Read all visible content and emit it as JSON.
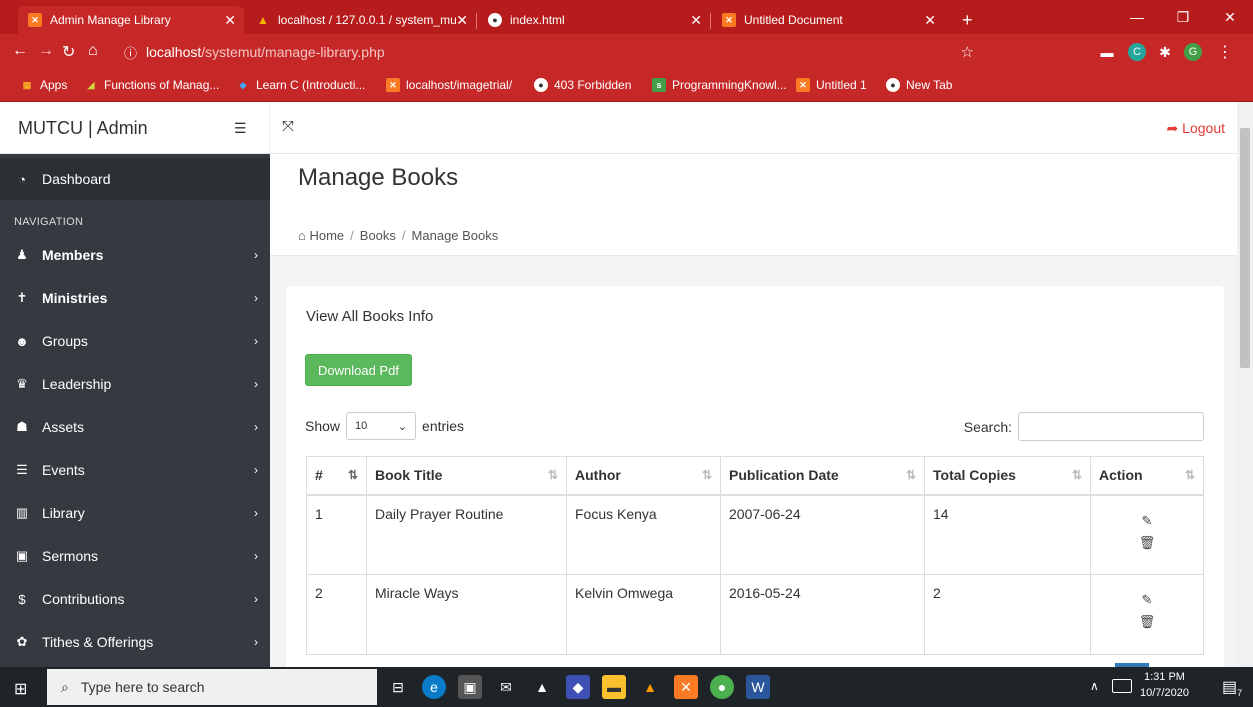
{
  "browser": {
    "tabs": [
      {
        "title": "Admin Manage Library",
        "icon": "xampp-icon"
      },
      {
        "title": "localhost / 127.0.0.1 / system_mu",
        "icon": "phpmyadmin-icon"
      },
      {
        "title": "index.html",
        "icon": "globe-icon"
      },
      {
        "title": "Untitled Document",
        "icon": "xampp-icon"
      }
    ],
    "new_tab": "+",
    "url_host": "localhost",
    "url_path": "/systemut/manage-library.php",
    "profile_letter": "G",
    "bookmarks": [
      {
        "label": "Apps",
        "icon": "apps-grid-icon"
      },
      {
        "label": "Functions of Manag...",
        "icon": "bookmark-icon"
      },
      {
        "label": "Learn C (Introducti...",
        "icon": "bookmark-icon"
      },
      {
        "label": "localhost/imagetrial/",
        "icon": "xampp-icon"
      },
      {
        "label": "403 Forbidden",
        "icon": "globe-icon"
      },
      {
        "label": "ProgrammingKnowl...",
        "icon": "bookmark-icon"
      },
      {
        "label": "Untitled 1",
        "icon": "xampp-icon"
      },
      {
        "label": "New Tab",
        "icon": "globe-icon"
      }
    ]
  },
  "app": {
    "brand": "MUTCU | Admin",
    "logout": "Logout",
    "sidebar": {
      "dashboard": "Dashboard",
      "nav_label": "NAVIGATION",
      "items": [
        {
          "label": "Members",
          "icon": "user-icon"
        },
        {
          "label": "Ministries",
          "icon": "ministry-icon"
        },
        {
          "label": "Groups",
          "icon": "users-icon"
        },
        {
          "label": "Leadership",
          "icon": "crown-icon"
        },
        {
          "label": "Assets",
          "icon": "assets-icon"
        },
        {
          "label": "Events",
          "icon": "list-icon"
        },
        {
          "label": "Library",
          "icon": "book-icon"
        },
        {
          "label": "Sermons",
          "icon": "sermon-icon"
        },
        {
          "label": "Contributions",
          "icon": "money-icon"
        },
        {
          "label": "Tithes & Offerings",
          "icon": "gift-icon"
        }
      ]
    },
    "page": {
      "title": "Manage Books",
      "breadcrumb": [
        "Home",
        "Books",
        "Manage Books"
      ],
      "card_title": "View All Books Info",
      "download_btn": "Download Pdf",
      "show_label": "Show",
      "entries_value": "10",
      "entries_label": "entries",
      "search_label": "Search:",
      "search_value": "",
      "columns": [
        "#",
        "Book Title",
        "Author",
        "Publication Date",
        "Total Copies",
        "Action"
      ],
      "rows": [
        {
          "num": "1",
          "title": "Daily Prayer Routine",
          "author": "Focus Kenya",
          "date": "2007-06-24",
          "copies": "14"
        },
        {
          "num": "2",
          "title": "Miracle Ways",
          "author": "Kelvin Omwega",
          "date": "2016-05-24",
          "copies": "2"
        }
      ]
    }
  },
  "taskbar": {
    "search_placeholder": "Type here to search",
    "time": "1:31 PM",
    "date": "10/7/2020",
    "notifications": "7"
  },
  "colors": {
    "chrome": "#c62828",
    "sidebar": "#343a40",
    "download": "#5cb85c",
    "logout": "#e53935"
  }
}
